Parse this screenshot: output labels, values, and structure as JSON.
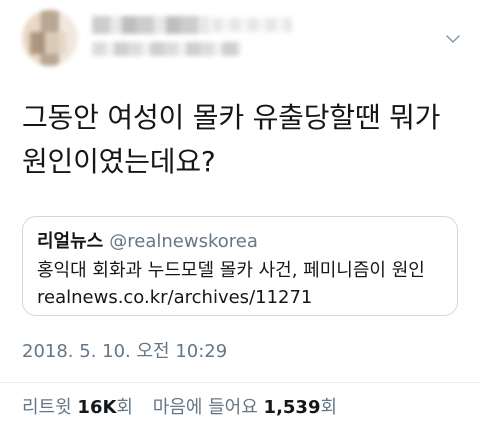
{
  "tweet": {
    "text": "그동안 여성이 몰카 유출당할땐 뭐가 원인이였는데요?",
    "timestamp": "2018. 5. 10. 오전 10:29"
  },
  "quote": {
    "name": "리얼뉴스",
    "handle": "@realnewskorea",
    "text": "홍익대 회화과 누드모델 몰카 사건, 페미니즘이 원인",
    "link": "realnews.co.kr/archives/11271"
  },
  "stats": {
    "retweets_label": "리트윗",
    "retweets_count": "16K",
    "retweets_suffix": "회",
    "likes_label": "마음에 들어요",
    "likes_count": "1,539",
    "likes_suffix": "회"
  },
  "icons": {
    "menu_chevron": "chevron-down-icon"
  },
  "colors": {
    "text_primary": "#14171a",
    "text_secondary": "#657786",
    "border": "#cfd9de"
  }
}
